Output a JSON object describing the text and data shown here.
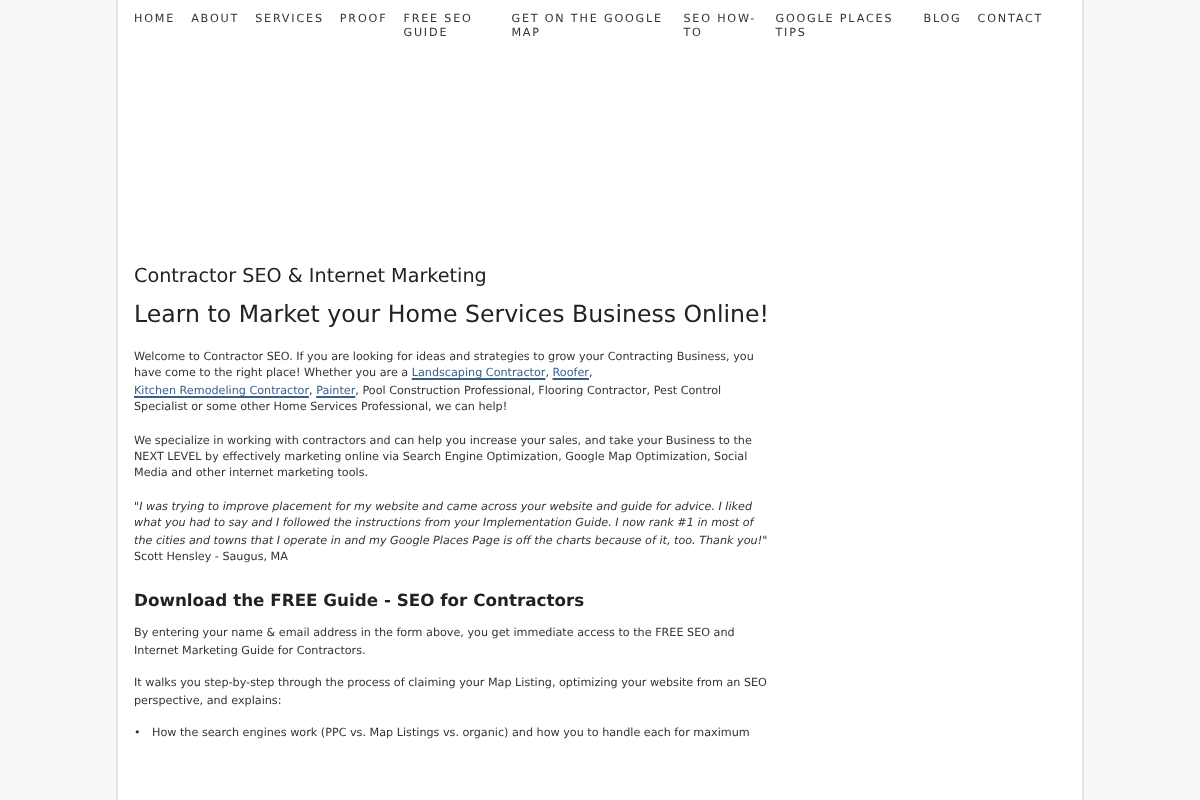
{
  "nav": [
    "HOME",
    "ABOUT",
    "SERVICES",
    "PROOF",
    "FREE SEO GUIDE",
    "GET ON THE GOOGLE MAP",
    "SEO HOW-TO",
    "GOOGLE PLACES TIPS",
    "BLOG",
    "CONTACT"
  ],
  "site_title": "Contractor SEO & Internet Marketing",
  "headline": "Learn to Market your Home Services Business Online!",
  "intro": [
    {
      "text": "Welcome to Contractor SEO. If you are looking for ideas and strategies to grow your Contracting Business, you have come to the right place! Whether you are a ",
      "link": false
    },
    {
      "text": "Landscaping Contractor",
      "link": true
    },
    {
      "text": ", ",
      "link": false
    },
    {
      "text": "Roofer",
      "link": true
    },
    {
      "text": ", ",
      "link": false
    },
    {
      "text": "Kitchen Remodeling Contractor",
      "link": true
    },
    {
      "text": ", ",
      "link": false
    },
    {
      "text": "Painter",
      "link": true
    },
    {
      "text": ", Pool Construction Professional, Flooring Contractor, Pest Control Specialist or some other Home Services Professional, we can help!",
      "link": false
    }
  ],
  "paragraph": "We specialize in working with contractors and can help you increase your sales, and take your Business to the NEXT LEVEL by effectively marketing online via Search Engine Optimization, Google Map Optimization, Social Media and other internet marketing tools.",
  "testimonial": {
    "quote": "\"I was trying to improve placement for my website and came across your website and guide for advice. I liked what you had to say and I followed the instructions from your Implementation Guide. I now rank #1 in most of the cities and towns that I operate in and my Google Places Page is off the charts because of it, too. Thank you!\"",
    "author": "Scott Hensley - Saugus, MA"
  },
  "guide": {
    "heading": "Download the FREE Guide - SEO for Contractors",
    "paragraphs": [
      "By entering your name & email address in the form above, you get immediate access to the FREE SEO and Internet Marketing Guide for Contractors.",
      "It walks you step-by-step through the process of claiming your Map Listing, optimizing your website from an SEO perspective, and explains:"
    ],
    "bullets": [
      {
        "marker": "•",
        "text": "How the search engines work (PPC vs. Map Listings vs. organic) and how you to handle each for maximum"
      }
    ]
  }
}
